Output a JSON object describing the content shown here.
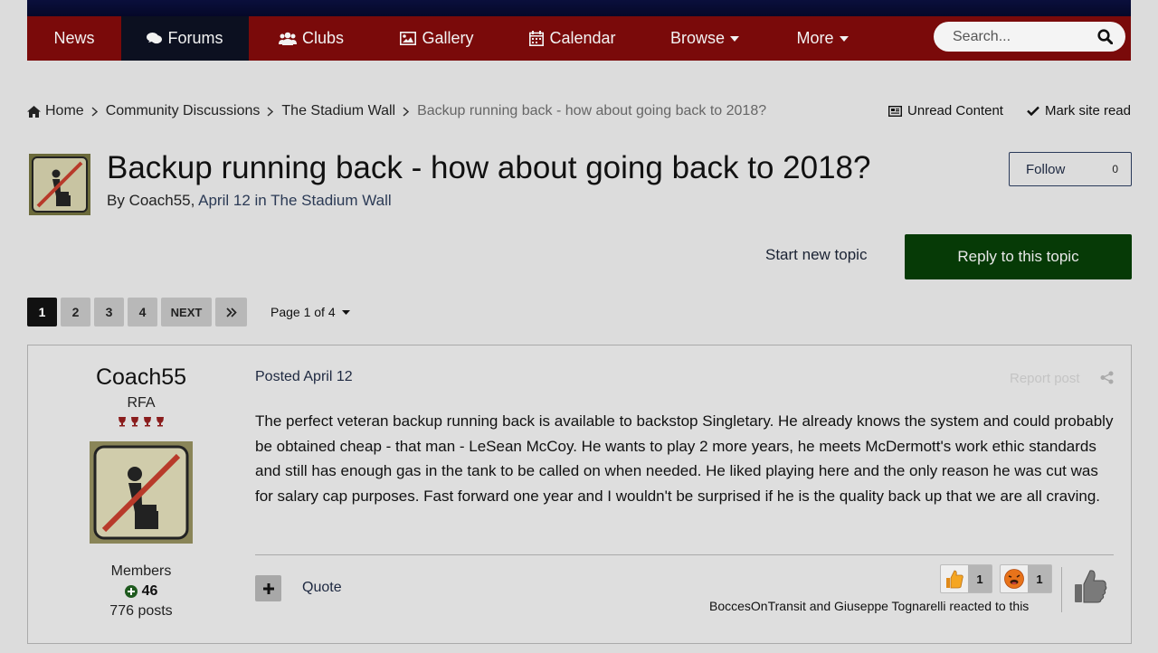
{
  "nav": {
    "items": [
      {
        "label": "News",
        "icon": ""
      },
      {
        "label": "Forums",
        "icon": "comments-icon",
        "active": true
      },
      {
        "label": "Clubs",
        "icon": "users-icon"
      },
      {
        "label": "Gallery",
        "icon": "image-icon"
      },
      {
        "label": "Calendar",
        "icon": "calendar-icon"
      },
      {
        "label": "Browse",
        "icon": "caret-down-icon"
      },
      {
        "label": "More",
        "icon": "caret-down-icon"
      }
    ],
    "search_placeholder": "Search..."
  },
  "breadcrumb": {
    "items": [
      "Home",
      "Community Discussions",
      "The Stadium Wall"
    ],
    "current": "Backup running back - how about going back to 2018?"
  },
  "util": {
    "unread": "Unread Content",
    "mark_read": "Mark site read"
  },
  "topic": {
    "title": "Backup running back - how about going back to 2018?",
    "by": "By ",
    "author": "Coach55",
    "date": "April 12",
    "in": " in ",
    "forum": "The Stadium Wall",
    "follow_label": "Follow",
    "follow_count": "0"
  },
  "actions": {
    "start_topic": "Start new topic",
    "reply": "Reply to this topic"
  },
  "pagination": {
    "pages": [
      "1",
      "2",
      "3",
      "4"
    ],
    "current": "1",
    "next": "NEXT",
    "page_of": "Page 1 of 4"
  },
  "post": {
    "author": {
      "name": "Coach55",
      "rank": "RFA",
      "rank_pips": 4,
      "group": "Members",
      "reputation": "46",
      "posts": "776 posts"
    },
    "posted": "Posted April 12",
    "report": "Report post",
    "body": "The perfect veteran backup running back is available to backstop Singletary.   He already knows the system and could probably be obtained cheap - that man - LeSean McCoy.   He wants to play 2 more years, he meets McDermott's work ethic standards and still has enough gas in the tank to be called on when needed.  He liked playing here and the only reason he was cut was for salary cap purposes.  Fast forward one year and I wouldn't be surprised if he is the quality back up that we are all craving.",
    "quote": "Quote",
    "reactions": [
      {
        "icon": "thumbs-up-icon",
        "count": "1"
      },
      {
        "icon": "haha-icon",
        "count": "1"
      }
    ],
    "reacted_text": "BoccesOnTransit and Giuseppe Tognarelli reacted to this"
  },
  "colors": {
    "nav_bg": "#7a0a0a",
    "nav_active": "#0c1020",
    "reply_btn": "#063a06",
    "page_bg": "#dcdcdc"
  }
}
